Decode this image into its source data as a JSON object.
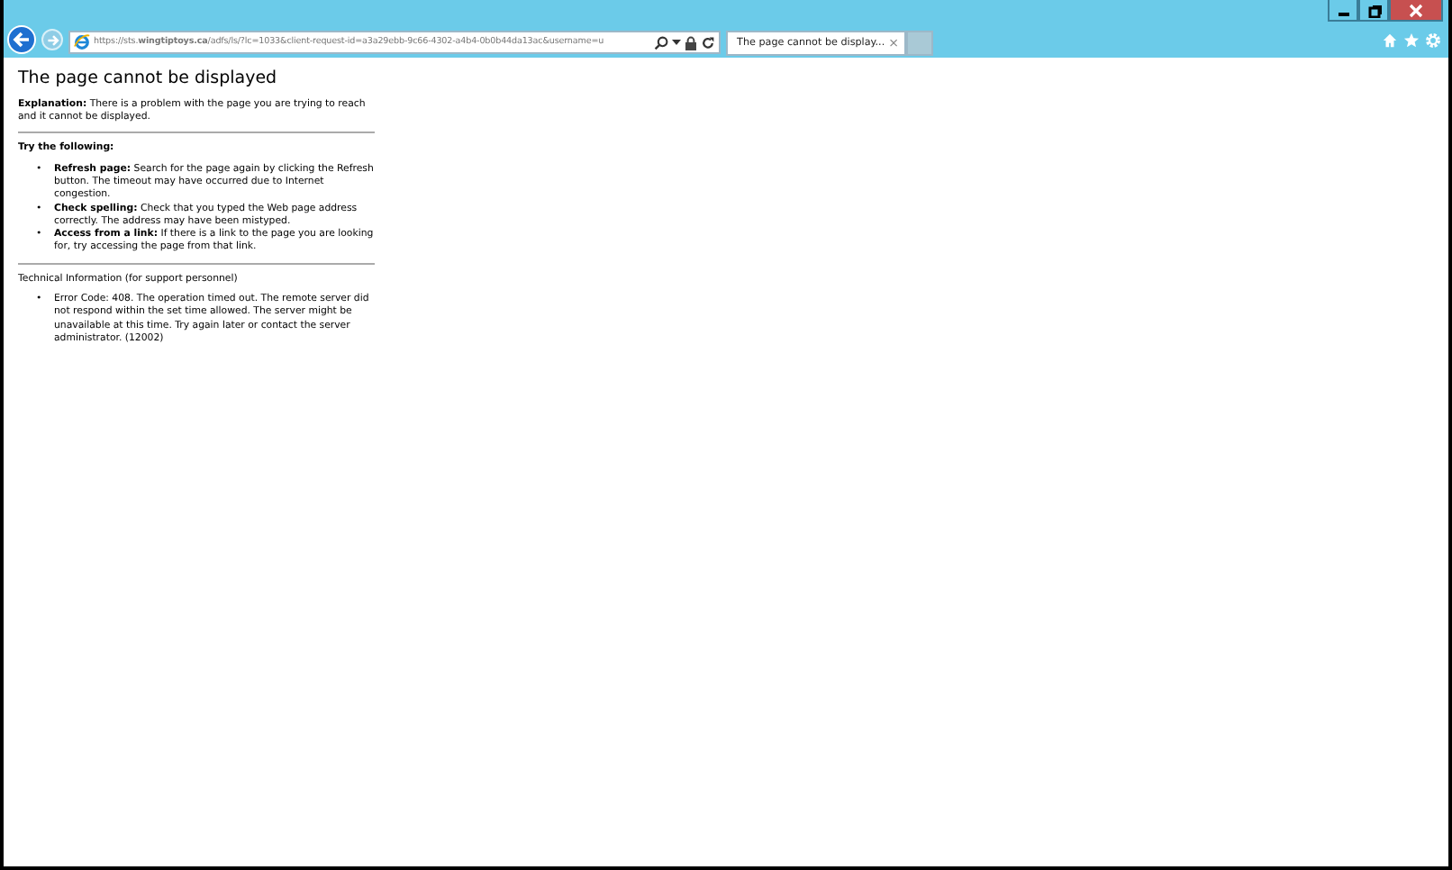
{
  "address_bar": {
    "url": "https://sts.**wingtiptoys.ca**/adfs/ls/?lc=1033&client-request-id=a3a29ebb-9c66-4302-a4b4-0b0b44da13ac&username=u"
  },
  "tabs": [
    {
      "label": "The page cannot be display...",
      "close": "×",
      "selected": true
    }
  ],
  "page": {
    "title": "The page cannot be displayed",
    "explanation": "**Explanation:** There is a problem with the page you are trying to reach and it cannot be displayed.",
    "try_heading": "Try the following:",
    "suggestions": [
      {
        "marker": "•",
        "text": "**Refresh page:** Search for the page again by clicking the Refresh button. The timeout may have occurred due to Internet congestion."
      },
      {
        "marker": "•",
        "text": "**Check spelling:** Check that you typed the Web page address correctly. The address may have been mistyped."
      },
      {
        "marker": "•",
        "text": "**Access from a link:** If there is a link to the page you are looking for, try accessing the page from that link."
      }
    ],
    "technical_heading": "Technical Information (for support personnel)",
    "technical_items": [
      {
        "marker": "•",
        "text": "Error Code: 408. The operation timed out. The remote server did not respond within the set time allowed. The server might be unavailable at this time. Try again later or contact the server administrator. (12002)"
      }
    ]
  }
}
